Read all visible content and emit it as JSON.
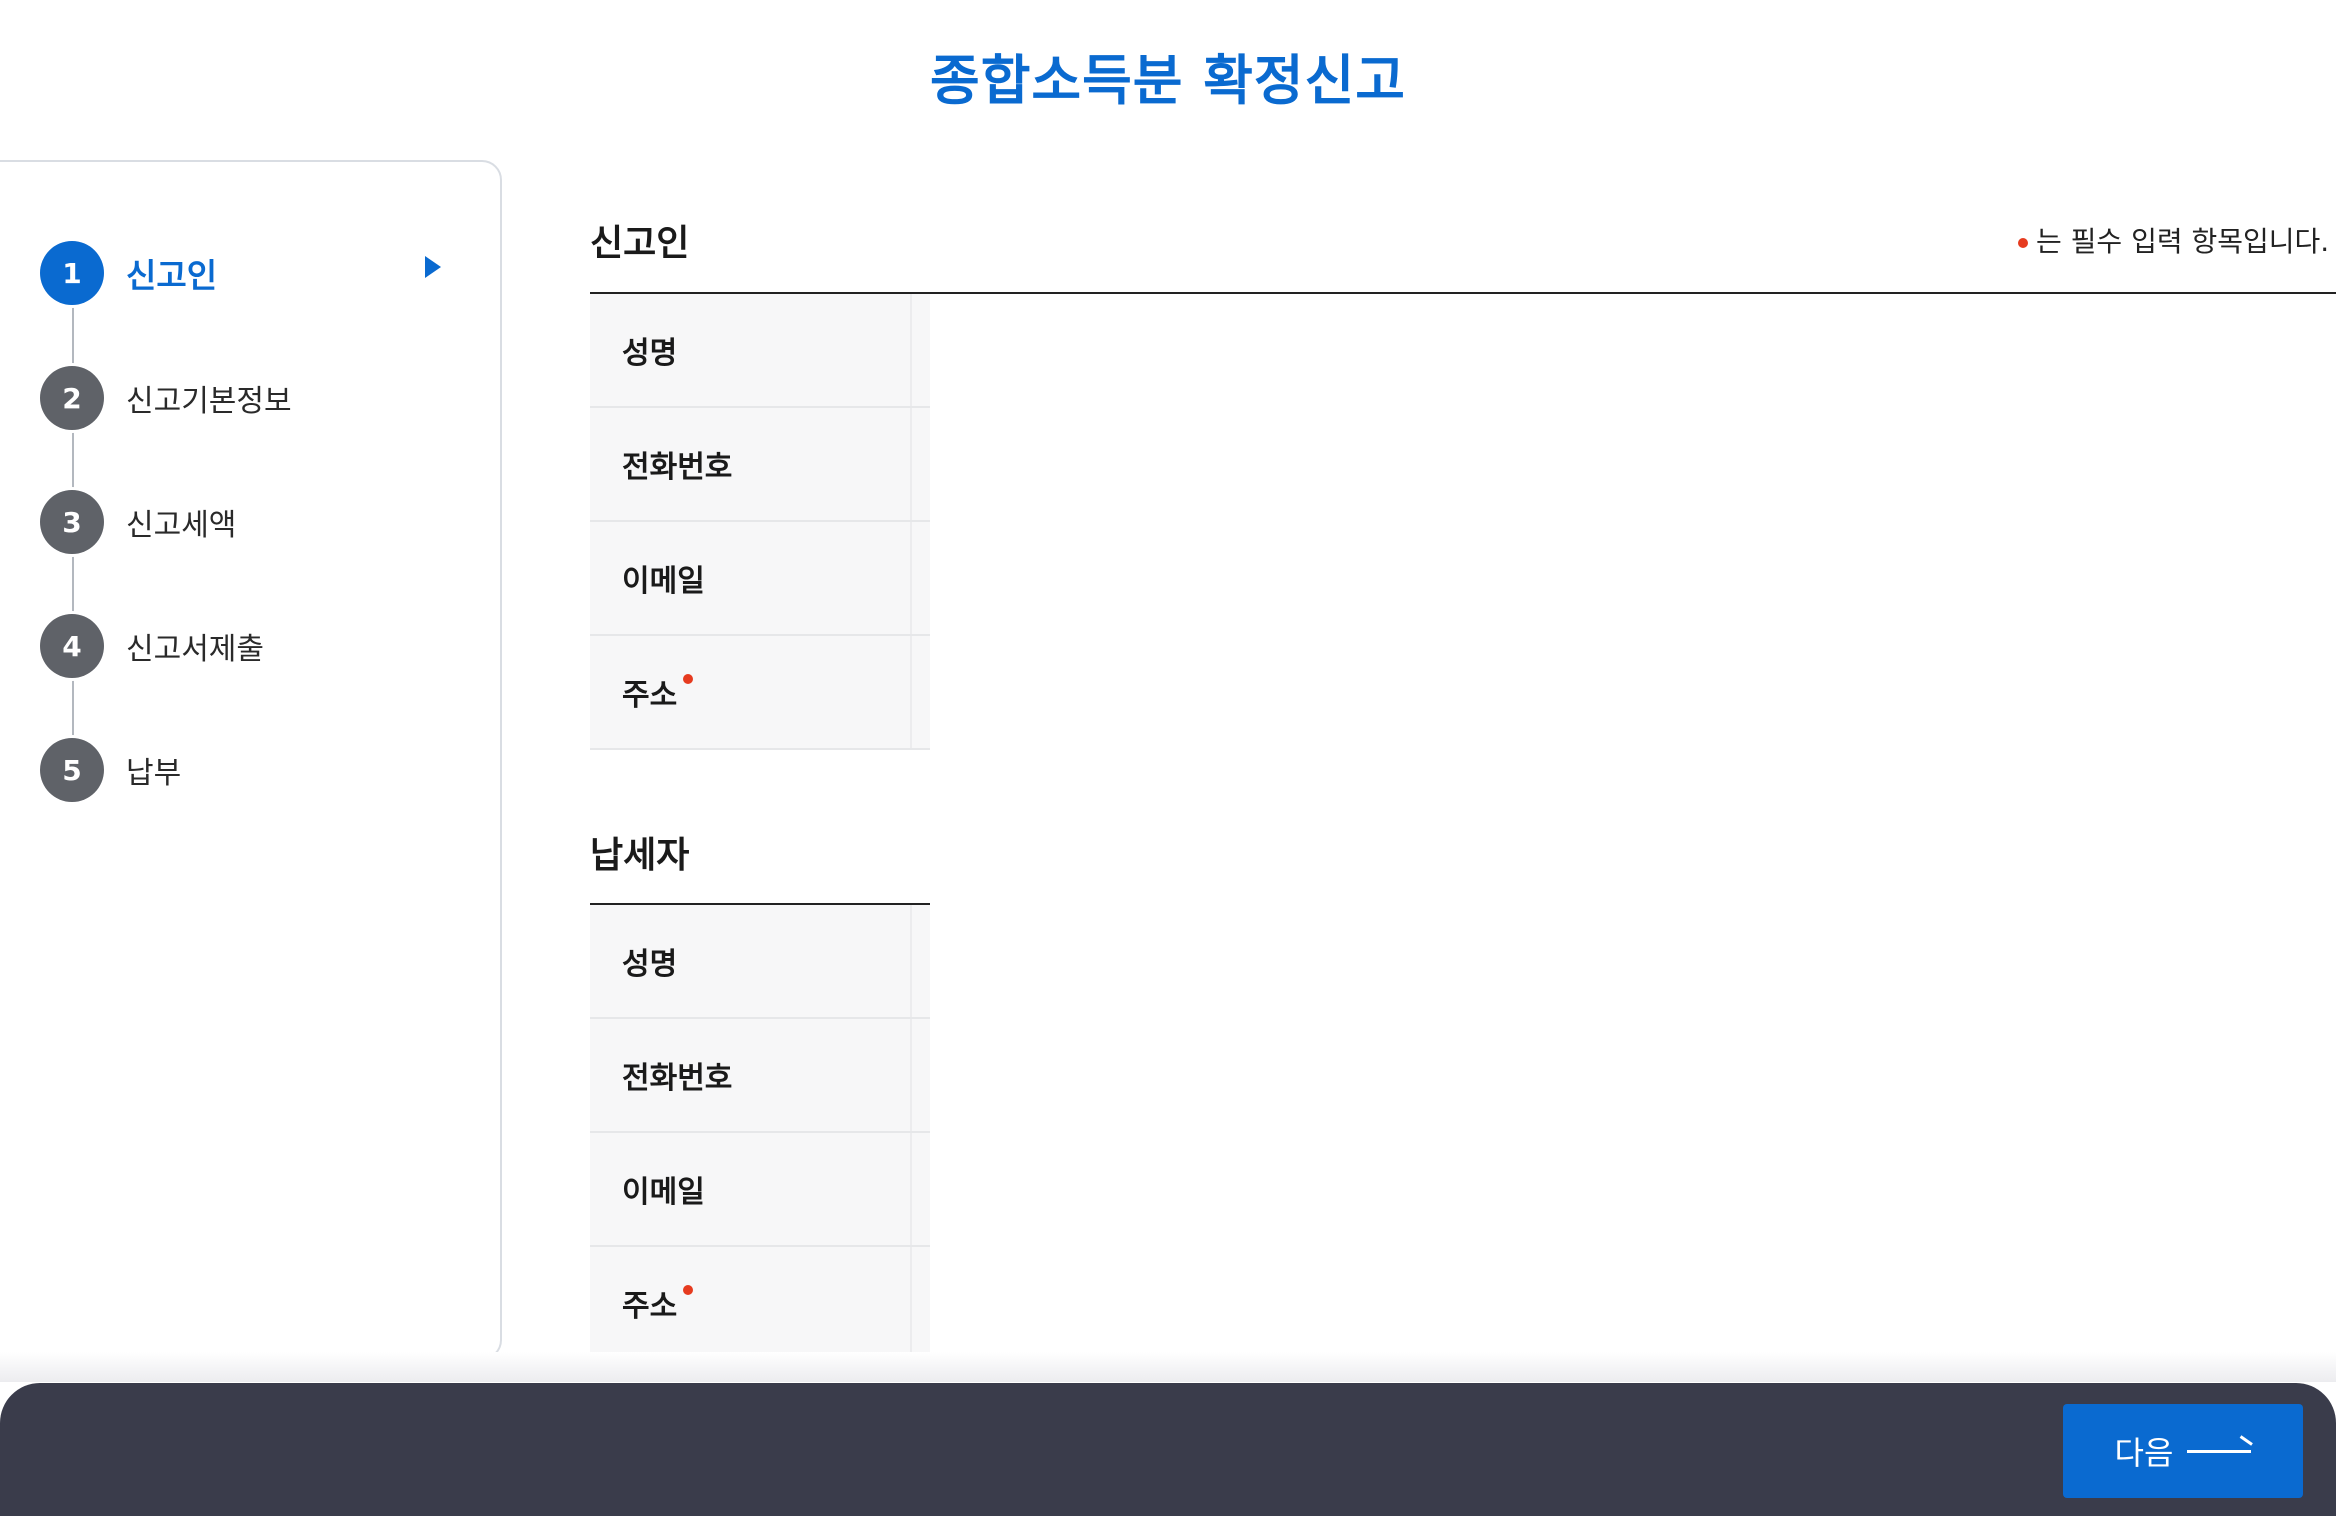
{
  "page": {
    "title": "종합소득분 확정신고"
  },
  "stepper": {
    "steps": [
      {
        "number": "1",
        "label": "신고인",
        "active": true
      },
      {
        "number": "2",
        "label": "신고기본정보",
        "active": false
      },
      {
        "number": "3",
        "label": "신고세액",
        "active": false
      },
      {
        "number": "4",
        "label": "신고서제출",
        "active": false
      },
      {
        "number": "5",
        "label": "납부",
        "active": false
      }
    ],
    "active_color": "#0a6ad0",
    "inactive_color": "#5f6268",
    "current_indicator_icon": "triangle-right-icon"
  },
  "required_note": "는 필수 입력 항목입니다.",
  "sections": {
    "reporter": {
      "title": "신고인",
      "rows": [
        {
          "label": "성명",
          "required": false
        },
        {
          "label": "전화번호",
          "required": false
        },
        {
          "label": "이메일",
          "required": false
        },
        {
          "label": "주소",
          "required": true
        }
      ]
    },
    "taxpayer": {
      "title": "납세자",
      "rows": [
        {
          "label": "성명",
          "required": false
        },
        {
          "label": "전화번호",
          "required": false
        },
        {
          "label": "이메일",
          "required": false
        },
        {
          "label": "주소",
          "required": true
        }
      ]
    }
  },
  "footer": {
    "next_label": "다음",
    "next_icon": "arrow-right-icon"
  },
  "colors": {
    "brand": "#0a6ad0",
    "required": "#e63b1f",
    "footer_bg": "#3a3c4b"
  }
}
